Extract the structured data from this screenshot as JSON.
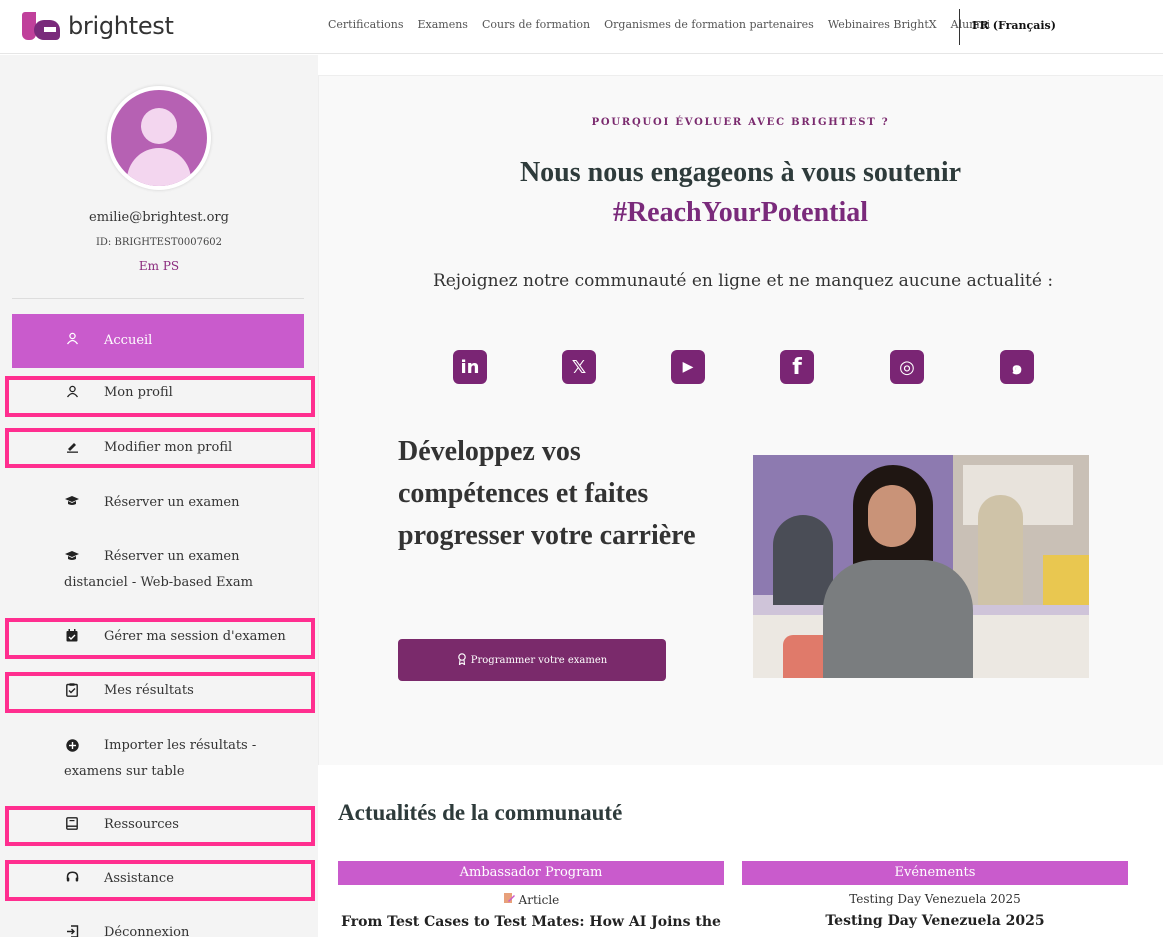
{
  "brand": {
    "name": "brightest"
  },
  "nav": {
    "items": [
      "Certifications",
      "Examens",
      "Cours de formation",
      "Organismes de formation partenaires",
      "Webinaires BrightX",
      "Alumni"
    ],
    "language": "FR (Français)"
  },
  "profile": {
    "email": "emilie@brightest.org",
    "id": "ID: BRIGHTEST0007602",
    "name": "Em PS"
  },
  "sidebar": {
    "items": [
      {
        "label": "Accueil",
        "icon": "user-icon",
        "active": true
      },
      {
        "label": "Mon profil",
        "icon": "user-icon"
      },
      {
        "label": "Modifier mon profil",
        "icon": "pencil-icon"
      },
      {
        "label": "Réserver un examen",
        "icon": "graduation-cap-icon"
      },
      {
        "label": "Réserver un examen distanciel - Web-based Exam",
        "icon": "graduation-cap-icon"
      },
      {
        "label": "Gérer ma session d'examen",
        "icon": "calendar-check-icon"
      },
      {
        "label": "Mes résultats",
        "icon": "clipboard-check-icon"
      },
      {
        "label": "Importer les résultats - examens sur table",
        "icon": "plus-circle-icon"
      },
      {
        "label": "Ressources",
        "icon": "book-icon"
      },
      {
        "label": "Assistance",
        "icon": "headset-icon"
      },
      {
        "label": "Déconnexion",
        "icon": "logout-icon"
      }
    ]
  },
  "hero": {
    "eyebrow": "POURQUOI ÉVOLUER AVEC BRIGHTEST ?",
    "headline": "Nous nous engageons à vous soutenir",
    "hashtag": "#ReachYourPotential",
    "join_text": "Rejoignez notre communauté en ligne et ne manquez aucune actualité :"
  },
  "social": [
    {
      "name": "linkedin-icon",
      "glyph": "in"
    },
    {
      "name": "x-icon",
      "glyph": "𝕏"
    },
    {
      "name": "youtube-icon",
      "glyph": "▶"
    },
    {
      "name": "facebook-icon",
      "glyph": "f"
    },
    {
      "name": "instagram-icon",
      "glyph": "◎"
    },
    {
      "name": "weibo-icon",
      "glyph": "๑"
    }
  ],
  "develop": {
    "heading": "Développez vos compétences et faites progresser votre carrière",
    "cta": "Programmer votre examen"
  },
  "news": {
    "title": "Actualités de la communauté",
    "cards": [
      {
        "category": "Ambassador Program",
        "subtitle": "Article",
        "title": "From Test Cases to Test Mates: How AI Joins the"
      },
      {
        "category": "Evénements",
        "subtitle": "Testing Day Venezuela 2025",
        "title": "Testing Day Venezuela 2025"
      }
    ]
  },
  "colors": {
    "accent": "#c95bcc",
    "brand_dark": "#7a2a7b",
    "highlight": "#ff2e8f"
  }
}
